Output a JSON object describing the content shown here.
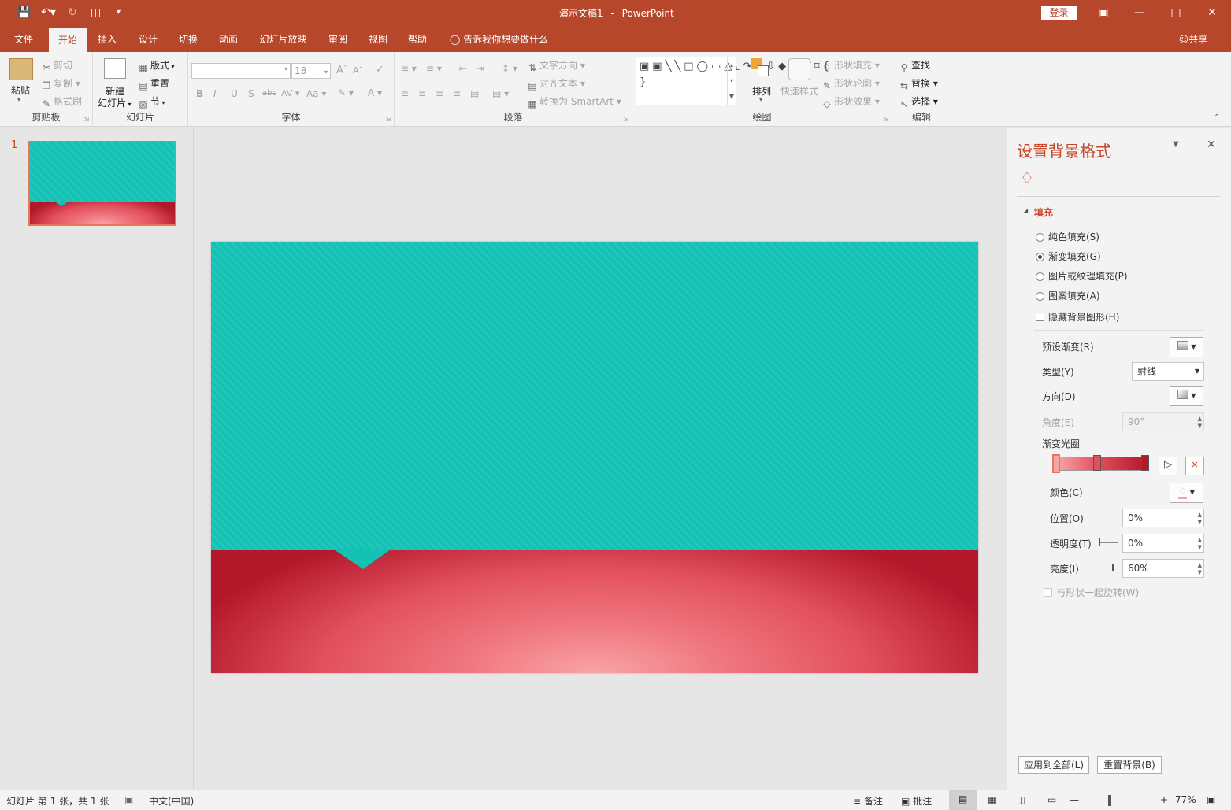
{
  "titlebar": {
    "doc_title": "演示文稿1",
    "separator": "-",
    "app_name": "PowerPoint",
    "login_label": "登录",
    "accent": "#b7472a"
  },
  "tabs": {
    "items": [
      "文件",
      "开始",
      "插入",
      "设计",
      "切换",
      "动画",
      "幻灯片放映",
      "审阅",
      "视图",
      "帮助"
    ],
    "active": "开始",
    "tell_me": "告诉我你想要做什么",
    "share": "共享"
  },
  "ribbon": {
    "clipboard": {
      "label": "剪贴板",
      "paste": "粘贴",
      "cut": "剪切",
      "copy": "复制",
      "format_painter": "格式刷"
    },
    "slides": {
      "label": "幻灯片",
      "new_slide_1": "新建",
      "new_slide_2": "幻灯片",
      "layout": "版式",
      "reset": "重置",
      "section": "节"
    },
    "font": {
      "label": "字体",
      "font_name": "",
      "font_size": "18",
      "bold": "B",
      "italic": "I",
      "underline": "U",
      "shadow": "S",
      "strike": "abc",
      "spacing": "AV",
      "case": "Aa",
      "color": "A"
    },
    "paragraph": {
      "label": "段落",
      "text_direction": "文字方向",
      "align_text": "对齐文本",
      "convert_smartart": "转换为 SmartArt"
    },
    "drawing": {
      "label": "绘图",
      "arrange": "排列",
      "quick_styles": "快速样式",
      "shape_fill": "形状填充",
      "shape_outline": "形状轮廓",
      "shape_effects": "形状效果"
    },
    "editing": {
      "label": "编辑",
      "find": "查找",
      "replace": "替换",
      "select": "选择"
    }
  },
  "thumbnails": [
    {
      "number": "1"
    }
  ],
  "format_pane": {
    "title": "设置背景格式",
    "section": "填充",
    "options": {
      "solid": "纯色填充(S)",
      "gradient": "渐变填充(G)",
      "picture": "图片或纹理填充(P)",
      "pattern": "图案填充(A)"
    },
    "selected_option": "gradient",
    "hide_bg": "隐藏背景图形(H)",
    "preset_label": "预设渐变(R)",
    "type_label": "类型(Y)",
    "type_value": "射线",
    "direction_label": "方向(D)",
    "angle_label": "角度(E)",
    "angle_value": "90°",
    "stops_label": "渐变光圈",
    "color_label": "颜色(C)",
    "position_label": "位置(O)",
    "position_value": "0%",
    "transparency_label": "透明度(T)",
    "transparency_value": "0%",
    "brightness_label": "亮度(I)",
    "brightness_value": "60%",
    "rotate_label": "与形状一起旋转(W)",
    "apply_all": "应用到全部(L)",
    "reset_bg": "重置背景(B)"
  },
  "colors": {
    "teal": "#13c1b5",
    "red_dark": "#b3172a",
    "red_light": "#f8a4a6"
  },
  "statusbar": {
    "slide_info": "幻灯片 第 1 张，共 1 张",
    "language": "中文(中国)",
    "notes": "备注",
    "comments": "批注",
    "zoom": "77%"
  }
}
